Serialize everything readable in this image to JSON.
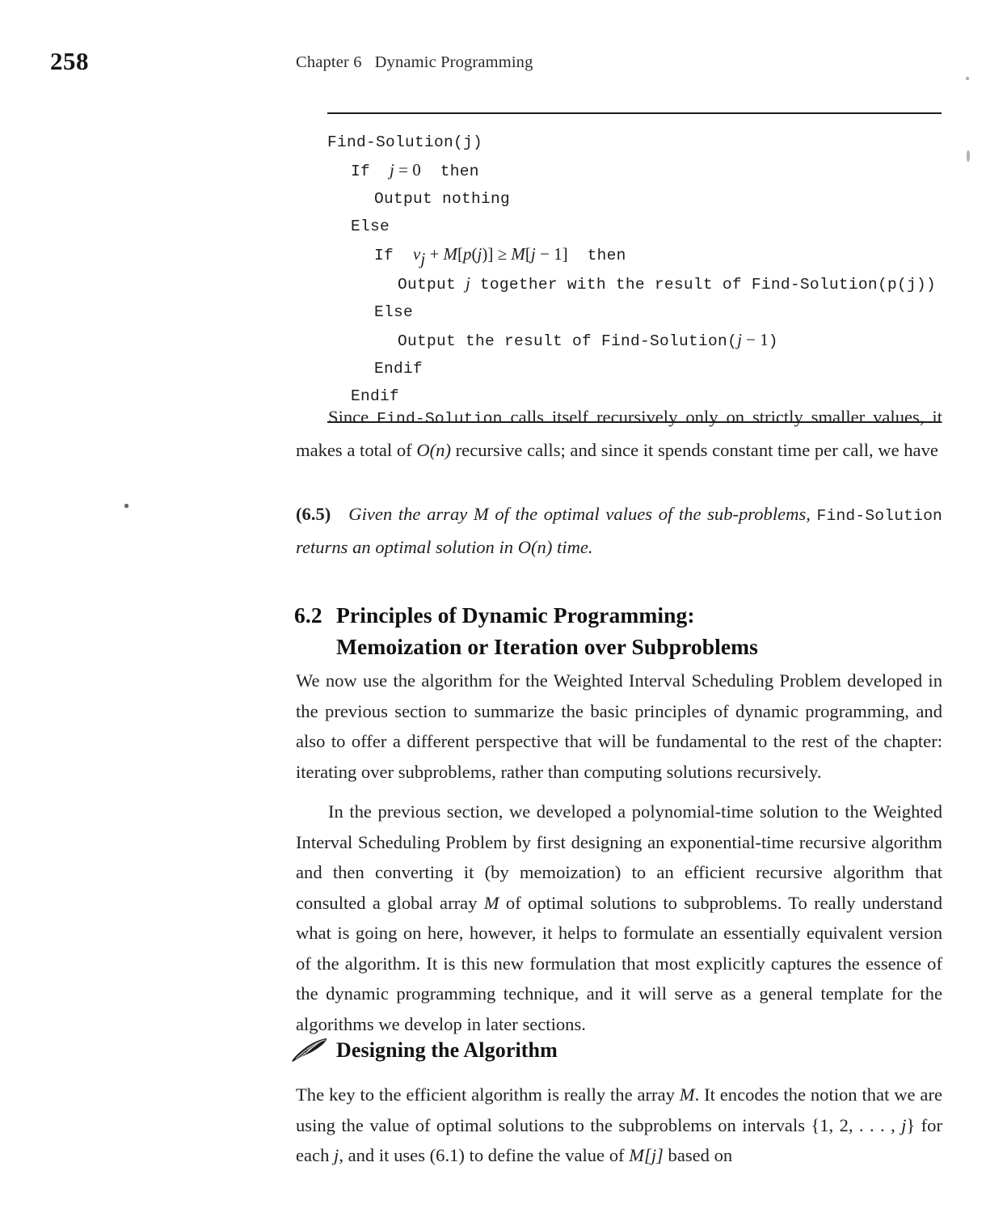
{
  "page": {
    "folio": "258",
    "running_head_chapter": "Chapter 6",
    "running_head_title": "Dynamic Programming"
  },
  "algorithm_box": {
    "lines": [
      {
        "indent": 0,
        "text": "Find-Solution(j)"
      },
      {
        "indent": 1,
        "text": "If  j = 0  then"
      },
      {
        "indent": 2,
        "text": "Output nothing"
      },
      {
        "indent": 1,
        "text": "Else"
      },
      {
        "indent": 2,
        "text": "If  v_j + M[p(j)] ≥ M[j − 1]  then"
      },
      {
        "indent": 3,
        "text": "Output j together with the result of Find-Solution(p(j))"
      },
      {
        "indent": 2,
        "text": "Else"
      },
      {
        "indent": 3,
        "text": "Output the result of Find-Solution(j − 1)"
      },
      {
        "indent": 2,
        "text": "Endif"
      },
      {
        "indent": 1,
        "text": "Endif"
      }
    ],
    "line_0": "Find-Solution(j)",
    "line_1_pre": "If  ",
    "line_1_math": "j = 0",
    "line_1_post": "  then",
    "line_2": "Output nothing",
    "line_3": "Else",
    "line_4_pre": "If  ",
    "line_4_post": "  then",
    "line_5_pre": "Output ",
    "line_5_post": " together with the result of Find-Solution(p(j))",
    "line_6": "Else",
    "line_7_pre": "Output the result of Find-Solution(",
    "line_7_math": "j − 1",
    "line_7_post": ")",
    "line_8": "Endif",
    "line_9": "Endif"
  },
  "paragraphs": {
    "after_algo": "Since Find-Solution calls itself recursively only on strictly smaller values, it makes a total of O(n) recursive calls; and since it spends constant time per call, we have",
    "after_algo_p1": "Since ",
    "after_algo_mono1": "Find-Solution",
    "after_algo_p2": " calls itself recursively only on strictly smaller values, it makes a total of ",
    "after_algo_math1": "O(n)",
    "after_algo_p3": " recursive calls; and since it spends constant time per call, we have",
    "sec_intro": "We now use the algorithm for the Weighted Interval Scheduling Problem developed in the previous section to summarize the basic principles of dynamic programming, and also to offer a different perspective that will be fundamental to the rest of the chapter: iterating over subproblems, rather than computing solutions recursively.",
    "sec_second_a": "In the previous section, we developed a polynomial-time solution to the Weighted Interval Scheduling Problem by first designing an exponential-time recursive algorithm and then converting it (by memoization) to an efficient recursive algorithm that consulted a global array ",
    "sec_second_math": "M",
    "sec_second_b": " of optimal solutions to subproblems. To really understand what is going on here, however, it helps to formulate an essentially equivalent version of the algorithm. It is this new formulation that most explicitly captures the essence of the dynamic programming technique, and it will serve as a general template for the algorithms we develop in later sections.",
    "design_a": "The key to the efficient algorithm is really the array ",
    "design_math1": "M",
    "design_b": ". It encodes the notion that we are using the value of optimal solutions to the subproblems on intervals {1, 2, . . . , ",
    "design_math2": "j",
    "design_c": "} for each ",
    "design_math3": "j",
    "design_d": ", and it uses (6.1) to define the value of ",
    "design_math4": "M[j]",
    "design_e": " based on"
  },
  "theorem": {
    "number": "(6.5)",
    "part1": "Given the array M of the optimal values of the sub-problems, ",
    "mono1": "Find-Solution",
    "part2": " returns an optimal solution in O(n) time."
  },
  "section_heading": {
    "number": "6.2",
    "line1": "Principles of Dynamic Programming:",
    "line2": "Memoization or Iteration over Subproblems"
  },
  "subsection_heading": {
    "icon": "quill-pen-icon",
    "label": "Designing the Algorithm"
  },
  "colors": {
    "page_background": "#ffffff",
    "text": "#222222",
    "rule": "#1d1d1d"
  }
}
